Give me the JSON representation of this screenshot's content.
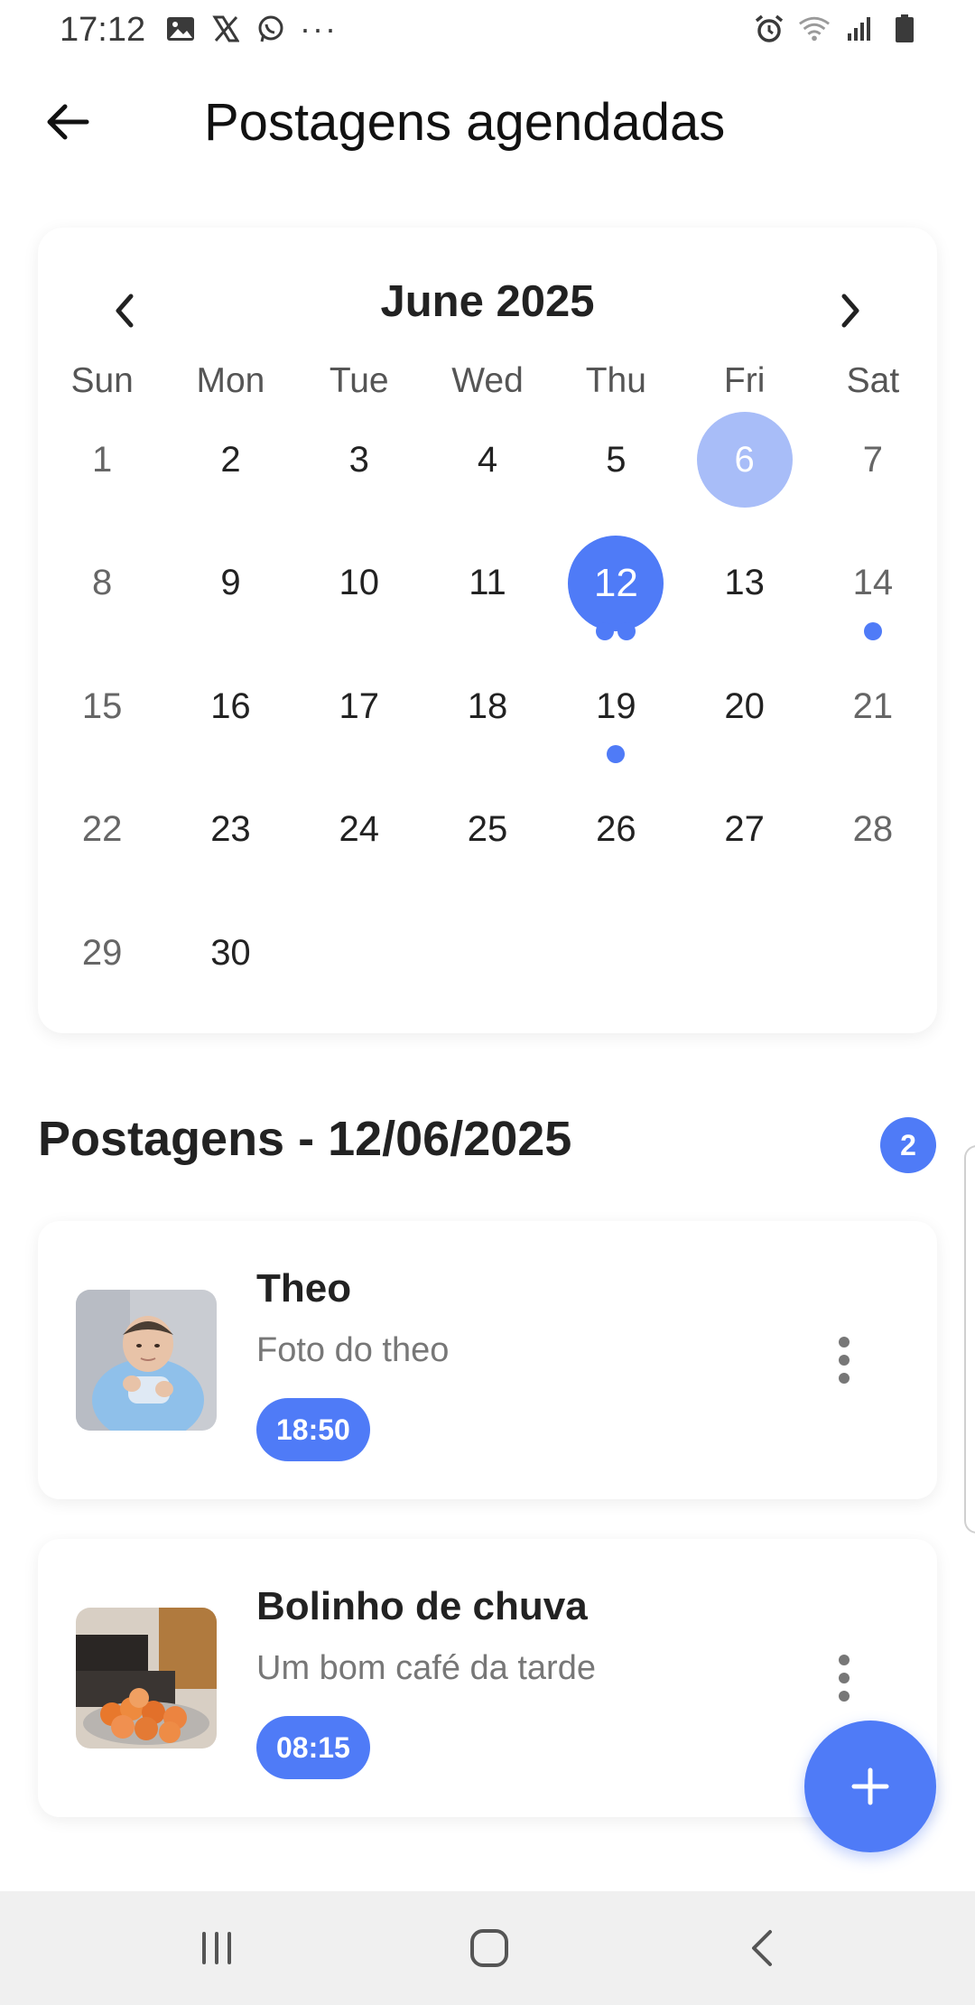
{
  "status_bar": {
    "time": "17:12",
    "left_icons": [
      "gallery-icon",
      "x-icon",
      "whatsapp-icon"
    ],
    "more": "···",
    "right_icons": [
      "alarm-icon",
      "wifi-icon",
      "signal-icon",
      "battery-icon"
    ]
  },
  "header": {
    "title": "Postagens agendadas",
    "back_icon": "arrow-left-icon"
  },
  "calendar": {
    "month_label": "June 2025",
    "weekdays": [
      "Sun",
      "Mon",
      "Tue",
      "Wed",
      "Thu",
      "Fri",
      "Sat"
    ],
    "weeks": [
      [
        "1",
        "2",
        "3",
        "4",
        "5",
        "6",
        "7"
      ],
      [
        "8",
        "9",
        "10",
        "11",
        "12",
        "13",
        "14"
      ],
      [
        "15",
        "16",
        "17",
        "18",
        "19",
        "20",
        "21"
      ],
      [
        "22",
        "23",
        "24",
        "25",
        "26",
        "27",
        "28"
      ],
      [
        "29",
        "30",
        "",
        "",
        "",
        "",
        ""
      ]
    ],
    "today": "6",
    "selected": "12",
    "markers": {
      "12": 2,
      "14": 1,
      "19": 1
    },
    "accent_color": "#4f7bf7",
    "today_color": "#a8bdf8"
  },
  "posts_section": {
    "title": "Postagens - 12/06/2025",
    "count": "2",
    "posts": [
      {
        "title": "Theo",
        "description": "Foto do theo",
        "time": "18:50"
      },
      {
        "title": "Bolinho de chuva",
        "description": "Um bom café da tarde",
        "time": "08:15"
      }
    ]
  },
  "fab": {
    "icon": "plus-icon"
  },
  "system_nav": {
    "icons": [
      "recents-icon",
      "home-icon",
      "back-nav-icon"
    ]
  }
}
